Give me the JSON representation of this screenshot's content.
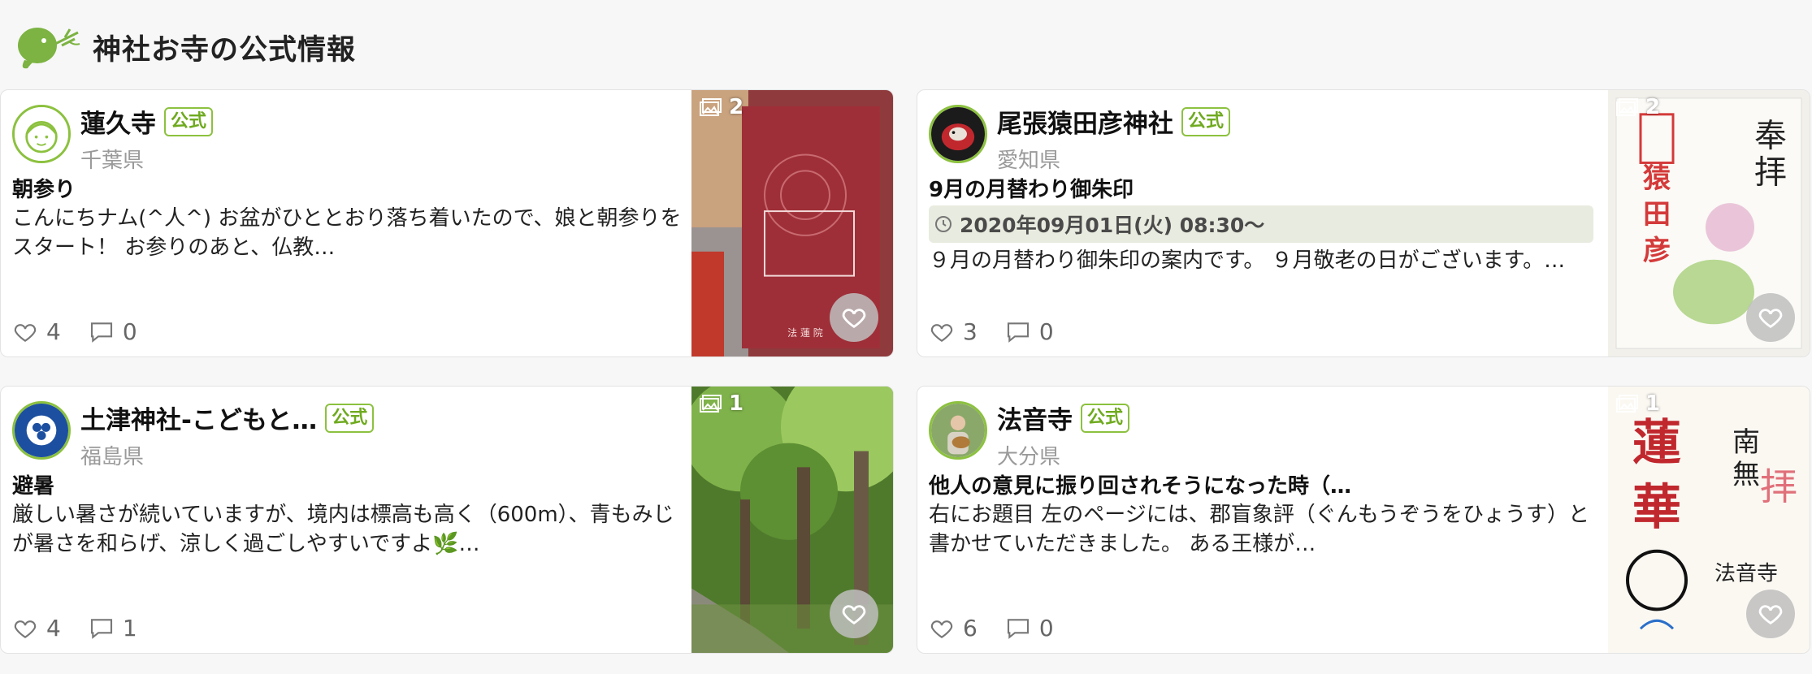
{
  "header": {
    "title": "神社お寺の公式情報"
  },
  "colors": {
    "accent": "#8cc13f",
    "badge_text": "#6faa1f",
    "muted": "#9a9a9a"
  },
  "cards": [
    {
      "name": "蓮久寺",
      "badge": "公式",
      "prefecture": "千葉県",
      "title": "朝参り",
      "excerpt": "こんにちナム(^人^) お盆がひととおり落ち着いたので、娘と朝参りをスタート！ お参りのあと、仏教…",
      "likes": "4",
      "comments": "0",
      "image_count": "2"
    },
    {
      "name": "尾張猿田彦神社",
      "badge": "公式",
      "prefecture": "愛知県",
      "title": "9月の月替わり御朱印",
      "event_date": "2020年09月01日(火) 08:30〜",
      "excerpt": "９月の月替わり御朱印の案内です。 ９月敬老の日がございます。…",
      "likes": "3",
      "comments": "0",
      "image_count": "2"
    },
    {
      "name": "土津神社-こどもと…",
      "badge": "公式",
      "prefecture": "福島県",
      "title": "避暑",
      "excerpt": "厳しい暑さが続いていますが、境内は標高も高く（600m）、青もみじが暑さを和らげ、涼しく過ごしやすいですよ🌿…",
      "likes": "4",
      "comments": "1",
      "image_count": "1"
    },
    {
      "name": "法音寺",
      "badge": "公式",
      "prefecture": "大分県",
      "title": "他人の意見に振り回されそうになった時（…",
      "excerpt": "右にお題目 左のページには、郡盲象評（ぐんもうぞうをひょうす）と書かせていただきました。 ある王様が…",
      "likes": "6",
      "comments": "0",
      "image_count": "1"
    }
  ]
}
